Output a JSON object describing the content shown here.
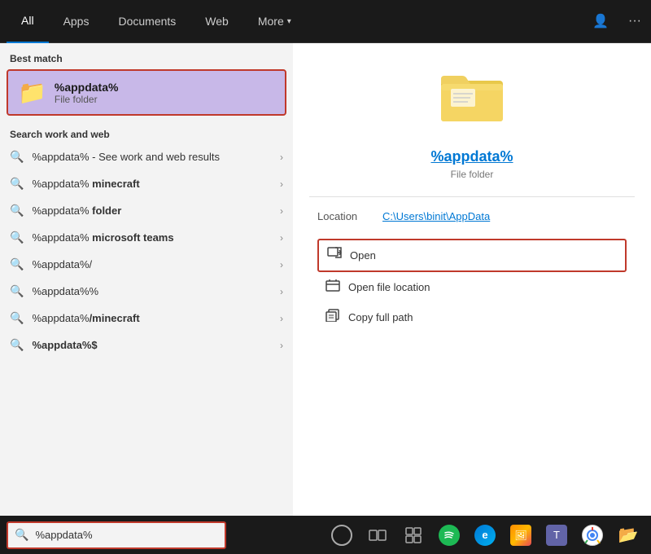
{
  "nav": {
    "tabs": [
      {
        "id": "all",
        "label": "All",
        "active": true
      },
      {
        "id": "apps",
        "label": "Apps"
      },
      {
        "id": "documents",
        "label": "Documents"
      },
      {
        "id": "web",
        "label": "Web"
      },
      {
        "id": "more",
        "label": "More",
        "hasArrow": true
      }
    ],
    "person_icon": "👤",
    "more_icon": "···"
  },
  "left": {
    "best_match_label": "Best match",
    "best_match": {
      "icon": "📁",
      "title": "%appdata%",
      "subtitle": "File folder"
    },
    "search_web_label": "Search work and web",
    "results": [
      {
        "text_normal": "%appdata%",
        "text_bold": " - See work and web results"
      },
      {
        "text_bold": "%appdata%",
        "text_normal": " minecraft"
      },
      {
        "text_bold": "%appdata%",
        "text_normal": " folder"
      },
      {
        "text_bold": "%appdata%",
        "text_normal": " microsoft teams"
      },
      {
        "text_normal": "%appdata%/",
        "text_bold": ""
      },
      {
        "text_bold": "%appdata%%",
        "text_normal": ""
      },
      {
        "text_bold": "%appdata%",
        "text_normal": "/minecraft"
      },
      {
        "text_bold": "%appdata%$",
        "text_normal": ""
      }
    ]
  },
  "right": {
    "folder_icon": "📁",
    "title": "%appdata%",
    "subtitle": "File folder",
    "location_label": "Location",
    "location_value": "C:\\Users\\binit\\AppData",
    "actions": [
      {
        "id": "open",
        "label": "Open",
        "icon": "⬜",
        "highlighted": true
      },
      {
        "id": "open-file-location",
        "label": "Open file location",
        "icon": "📄"
      },
      {
        "id": "copy-full-path",
        "label": "Copy full path",
        "icon": "📋"
      }
    ]
  },
  "taskbar": {
    "search_value": "%appdata%",
    "search_placeholder": "%appdata%",
    "icons": [
      {
        "id": "search",
        "symbol": "⊙"
      },
      {
        "id": "taskview",
        "symbol": "❑"
      },
      {
        "id": "widgets",
        "symbol": "⊞"
      },
      {
        "id": "spotify",
        "symbol": "🎵"
      },
      {
        "id": "edge",
        "symbol": "🌐"
      },
      {
        "id": "photos",
        "symbol": "🖼"
      },
      {
        "id": "teams",
        "symbol": "💬"
      },
      {
        "id": "chrome",
        "symbol": "🔵"
      },
      {
        "id": "fileexplorer",
        "symbol": "📂"
      }
    ]
  }
}
